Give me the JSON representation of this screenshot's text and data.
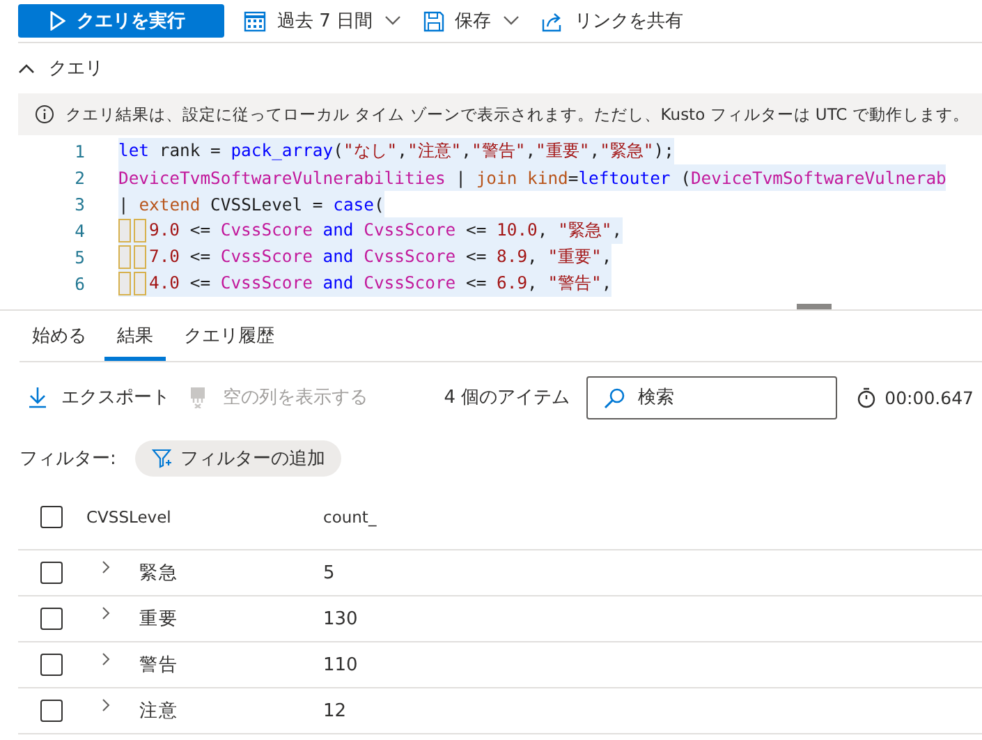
{
  "toolbar": {
    "run_button": "クエリを実行",
    "time_range": "過去 7 日間",
    "save": "保存",
    "share": "リンクを共有"
  },
  "query_section": {
    "title": "クエリ",
    "expanded": true,
    "notice": "クエリ結果は、設定に従ってローカル タイム ゾーンで表示されます。ただし、Kusto フィルターは UTC で動作します。"
  },
  "editor": {
    "lines": [
      {
        "number": "1",
        "kind": "top",
        "tokens": [
          {
            "kind": "keyword",
            "text": "let"
          },
          {
            "kind": "plain",
            "text": " rank = "
          },
          {
            "kind": "keyword",
            "text": "pack_array"
          },
          {
            "kind": "plain",
            "text": "("
          },
          {
            "kind": "string",
            "text": "\"なし\""
          },
          {
            "kind": "plain",
            "text": ","
          },
          {
            "kind": "string",
            "text": "\"注意\""
          },
          {
            "kind": "plain",
            "text": ","
          },
          {
            "kind": "string",
            "text": "\"警告\""
          },
          {
            "kind": "plain",
            "text": ","
          },
          {
            "kind": "string",
            "text": "\"重要\""
          },
          {
            "kind": "plain",
            "text": ","
          },
          {
            "kind": "string",
            "text": "\"緊急\""
          },
          {
            "kind": "plain",
            "text": ");"
          }
        ]
      },
      {
        "number": "2",
        "kind": "top",
        "tokens": [
          {
            "kind": "table",
            "text": "DeviceTvmSoftwareVulnerabilities"
          },
          {
            "kind": "plain",
            "text": " | "
          },
          {
            "kind": "operator",
            "text": "join kind"
          },
          {
            "kind": "plain",
            "text": "="
          },
          {
            "kind": "keyword",
            "text": "leftouter"
          },
          {
            "kind": "plain",
            "text": " ("
          },
          {
            "kind": "table",
            "text": "DeviceTvmSoftwareVulnerab"
          }
        ]
      },
      {
        "number": "3",
        "kind": "top",
        "tokens": [
          {
            "kind": "plain",
            "text": "| "
          },
          {
            "kind": "operator",
            "text": "extend"
          },
          {
            "kind": "plain",
            "text": " CVSSLevel = "
          },
          {
            "kind": "keyword",
            "text": "case"
          },
          {
            "kind": "plain",
            "text": "("
          }
        ]
      },
      {
        "number": "4",
        "kind": "case_branch",
        "tokens": [
          {
            "kind": "string",
            "text": "9.0"
          },
          {
            "kind": "plain",
            "text": " <= "
          },
          {
            "kind": "table",
            "text": "CvssScore"
          },
          {
            "kind": "keyword",
            "text": " and "
          },
          {
            "kind": "table",
            "text": "CvssScore"
          },
          {
            "kind": "plain",
            "text": " <= "
          },
          {
            "kind": "string",
            "text": "10.0"
          },
          {
            "kind": "plain",
            "text": ", "
          },
          {
            "kind": "string",
            "text": "\"緊急\""
          },
          {
            "kind": "plain",
            "text": ","
          }
        ]
      },
      {
        "number": "5",
        "kind": "case_branch",
        "tokens": [
          {
            "kind": "string",
            "text": "7.0"
          },
          {
            "kind": "plain",
            "text": " <= "
          },
          {
            "kind": "table",
            "text": "CvssScore"
          },
          {
            "kind": "keyword",
            "text": " and "
          },
          {
            "kind": "table",
            "text": "CvssScore"
          },
          {
            "kind": "plain",
            "text": " <= "
          },
          {
            "kind": "string",
            "text": "8.9"
          },
          {
            "kind": "plain",
            "text": ", "
          },
          {
            "kind": "string",
            "text": "\"重要\""
          },
          {
            "kind": "plain",
            "text": ","
          }
        ]
      },
      {
        "number": "6",
        "kind": "case_branch",
        "tokens": [
          {
            "kind": "string",
            "text": "4.0"
          },
          {
            "kind": "plain",
            "text": " <= "
          },
          {
            "kind": "table",
            "text": "CvssScore"
          },
          {
            "kind": "keyword",
            "text": " and "
          },
          {
            "kind": "table",
            "text": "CvssScore"
          },
          {
            "kind": "plain",
            "text": " <= "
          },
          {
            "kind": "string",
            "text": "6.9"
          },
          {
            "kind": "plain",
            "text": ", "
          },
          {
            "kind": "string",
            "text": "\"警告\""
          },
          {
            "kind": "plain",
            "text": ","
          }
        ]
      }
    ]
  },
  "tabs": [
    {
      "label": "始める",
      "selected": false
    },
    {
      "label": "結果",
      "selected": true
    },
    {
      "label": "クエリ履歴",
      "selected": false
    }
  ],
  "results_toolbar": {
    "export": "エクスポート",
    "show_empty_columns": {
      "label": "空の列を表示する",
      "disabled": true
    },
    "item_count": "4 個のアイテム",
    "search": {
      "placeholder": "検索"
    },
    "elapsed": "00:00.647"
  },
  "filter": {
    "label": "フィルター:",
    "add_button": "フィルターの追加"
  },
  "table": {
    "columns": [
      "CVSSLevel",
      "count_"
    ],
    "header_checked": false,
    "rows": [
      {
        "checked": false,
        "expanded": false,
        "cells": [
          "緊急",
          "5"
        ]
      },
      {
        "checked": false,
        "expanded": false,
        "cells": [
          "重要",
          "130"
        ]
      },
      {
        "checked": false,
        "expanded": false,
        "cells": [
          "警告",
          "110"
        ]
      },
      {
        "checked": false,
        "expanded": false,
        "cells": [
          "注意",
          "12"
        ]
      }
    ]
  }
}
